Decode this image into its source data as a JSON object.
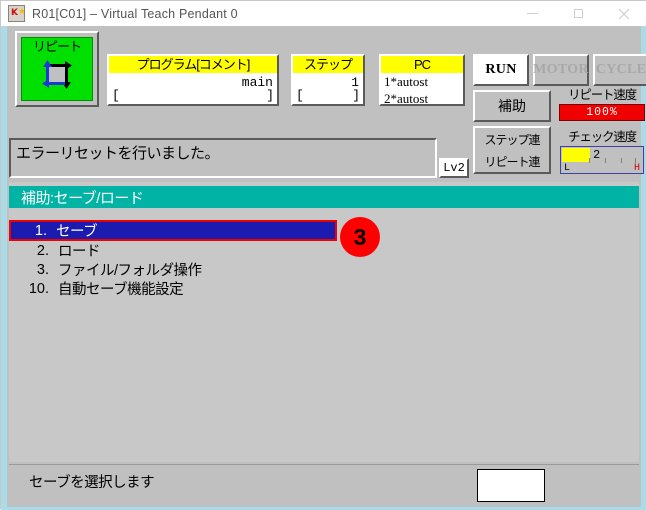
{
  "window": {
    "title": "R01[C01] – Virtual Teach Pendant 0",
    "icon": "app-robot-icon",
    "controls": {
      "minimize": "–",
      "maximize": "□",
      "close": "✕"
    }
  },
  "status_panel": {
    "mode_button": {
      "label": "リピート",
      "icon": "repeat-cycle-icon",
      "active": true,
      "color": "#00e000"
    },
    "program": {
      "caption": "プログラム[コメント]",
      "value": "main",
      "bracket_left": "[",
      "bracket_right": "]"
    },
    "step": {
      "caption": "ステップ",
      "value": "1",
      "bracket_left": "[",
      "bracket_right": "]"
    },
    "pc": {
      "caption": "PC",
      "lines": [
        "1*autost",
        "2*autost"
      ]
    },
    "run_button": {
      "label": "RUN",
      "enabled": true
    },
    "motor_button": {
      "label": "MOTOR",
      "enabled": false
    },
    "cycle_button": {
      "label": "CYCLE",
      "enabled": false
    },
    "aux_button": {
      "label": "補助"
    },
    "toggles": [
      {
        "label": "ステップ連"
      },
      {
        "label": "リピート連"
      }
    ],
    "repeat_speed": {
      "label": "リピート速度",
      "value": "100%",
      "bar_color": "#f00000"
    },
    "check_speed": {
      "label": "チェック速度",
      "value": "2",
      "low_mark": "L",
      "high_mark": "H",
      "fill_color": "#ffff00"
    }
  },
  "message_bar": {
    "text": "エラーリセットを行いました。",
    "level_badge": "Lv2"
  },
  "content": {
    "section_header": "補助:セーブ/ロード",
    "header_color": "#00b3a4",
    "menu_items": [
      {
        "number": "1.",
        "label": "セーブ",
        "selected": true
      },
      {
        "number": "2.",
        "label": "ロード",
        "selected": false
      },
      {
        "number": "3.",
        "label": "ファイル/フォルダ操作",
        "selected": false
      },
      {
        "number": "10.",
        "label": "自動セーブ機能設定",
        "selected": false
      }
    ],
    "annotation_badge": {
      "text": "3",
      "color": "#ff0000"
    }
  },
  "footer": {
    "hint": "セーブを選択します",
    "input_value": ""
  }
}
